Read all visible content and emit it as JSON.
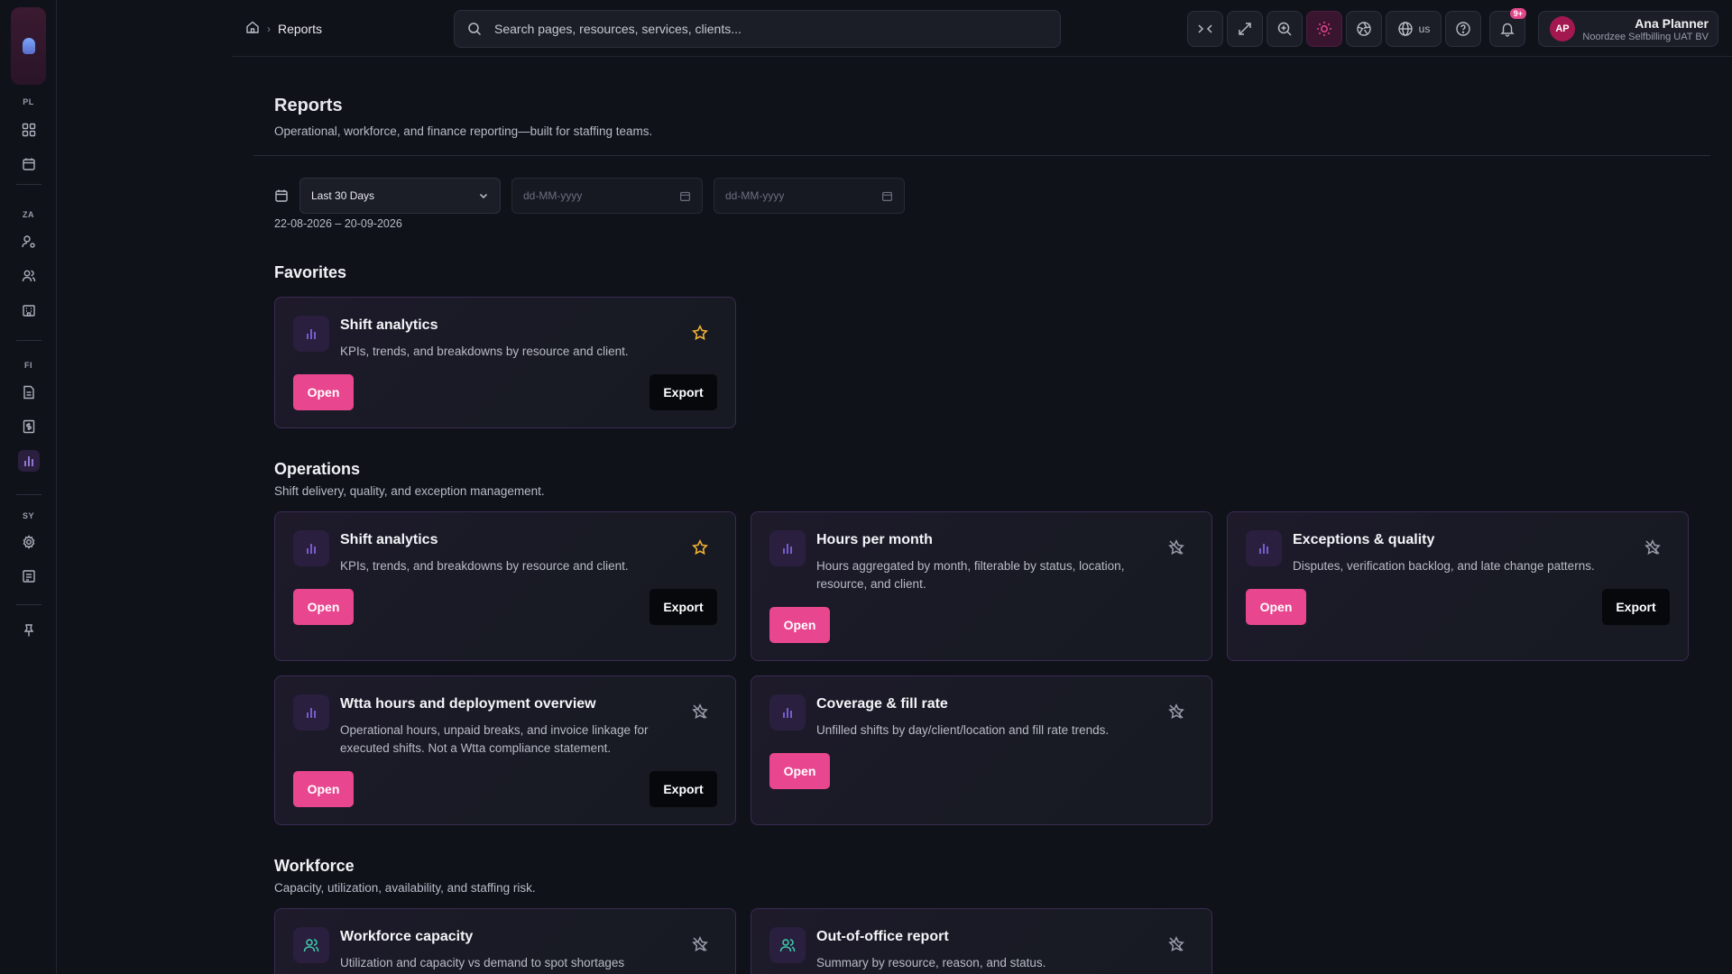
{
  "sidebar": {
    "groups": [
      {
        "label": "PL",
        "items": [
          {
            "icon": "dashboard-icon"
          },
          {
            "icon": "calendar-icon"
          }
        ]
      },
      {
        "label": "ZA",
        "items": [
          {
            "icon": "user-settings-icon"
          },
          {
            "icon": "users-icon"
          },
          {
            "icon": "building-icon"
          }
        ]
      },
      {
        "label": "FI",
        "items": [
          {
            "icon": "document-icon"
          },
          {
            "icon": "invoice-icon"
          },
          {
            "icon": "bar-chart-icon"
          }
        ]
      },
      {
        "label": "SY",
        "items": [
          {
            "icon": "gear-icon"
          },
          {
            "icon": "log-icon"
          }
        ]
      }
    ],
    "pin_icon": "pin-icon"
  },
  "topbar": {
    "breadcrumb": {
      "current": "Reports"
    },
    "search": {
      "placeholder": "Search pages, resources, services, clients..."
    },
    "language": "us",
    "notifications_badge": "9+",
    "user": {
      "initials": "AP",
      "name": "Ana Planner",
      "org": "Noordzee Selfbilling UAT BV"
    }
  },
  "page": {
    "title": "Reports",
    "subtitle": "Operational, workforce, and finance reporting—built for staffing teams."
  },
  "filters": {
    "period": "Last 30 Days",
    "from_placeholder": "dd-MM-yyyy",
    "to_placeholder": "dd-MM-yyyy",
    "range": "22-08-2026 – 20-09-2026"
  },
  "labels": {
    "open": "Open",
    "export": "Export"
  },
  "favorites": {
    "title": "Favorites",
    "cards": [
      {
        "title": "Shift analytics",
        "desc": "KPIs, trends, and breakdowns by resource and client.",
        "favorite": true
      }
    ]
  },
  "operations": {
    "title": "Operations",
    "subtitle": "Shift delivery, quality, and exception management.",
    "cards": [
      {
        "title": "Shift analytics",
        "desc": "KPIs, trends, and breakdowns by resource and client.",
        "favorite": true
      },
      {
        "title": "Hours per month",
        "desc": "Hours aggregated by month, filterable by status, location, resource, and client.",
        "favorite": false
      },
      {
        "title": "Exceptions & quality",
        "desc": "Disputes, verification backlog, and late change patterns.",
        "favorite": false
      },
      {
        "title": "Wtta hours and deployment overview",
        "desc": "Operational hours, unpaid breaks, and invoice linkage for executed shifts. Not a Wtta compliance statement.",
        "favorite": false
      },
      {
        "title": "Coverage & fill rate",
        "desc": "Unfilled shifts by day/client/location and fill rate trends.",
        "favorite": false
      }
    ]
  },
  "workforce": {
    "title": "Workforce",
    "subtitle": "Capacity, utilization, availability, and staffing risk.",
    "cards": [
      {
        "title": "Workforce capacity",
        "desc": "Utilization and capacity vs demand to spot shortages",
        "favorite": false
      },
      {
        "title": "Out-of-office report",
        "desc": "Summary by resource, reason, and status.",
        "favorite": false
      }
    ]
  },
  "colors": {
    "accent": "#e8468f",
    "icon_purple": "#8b6cf0",
    "icon_teal": "#3ecfb0",
    "star_gold": "#f2b233"
  }
}
